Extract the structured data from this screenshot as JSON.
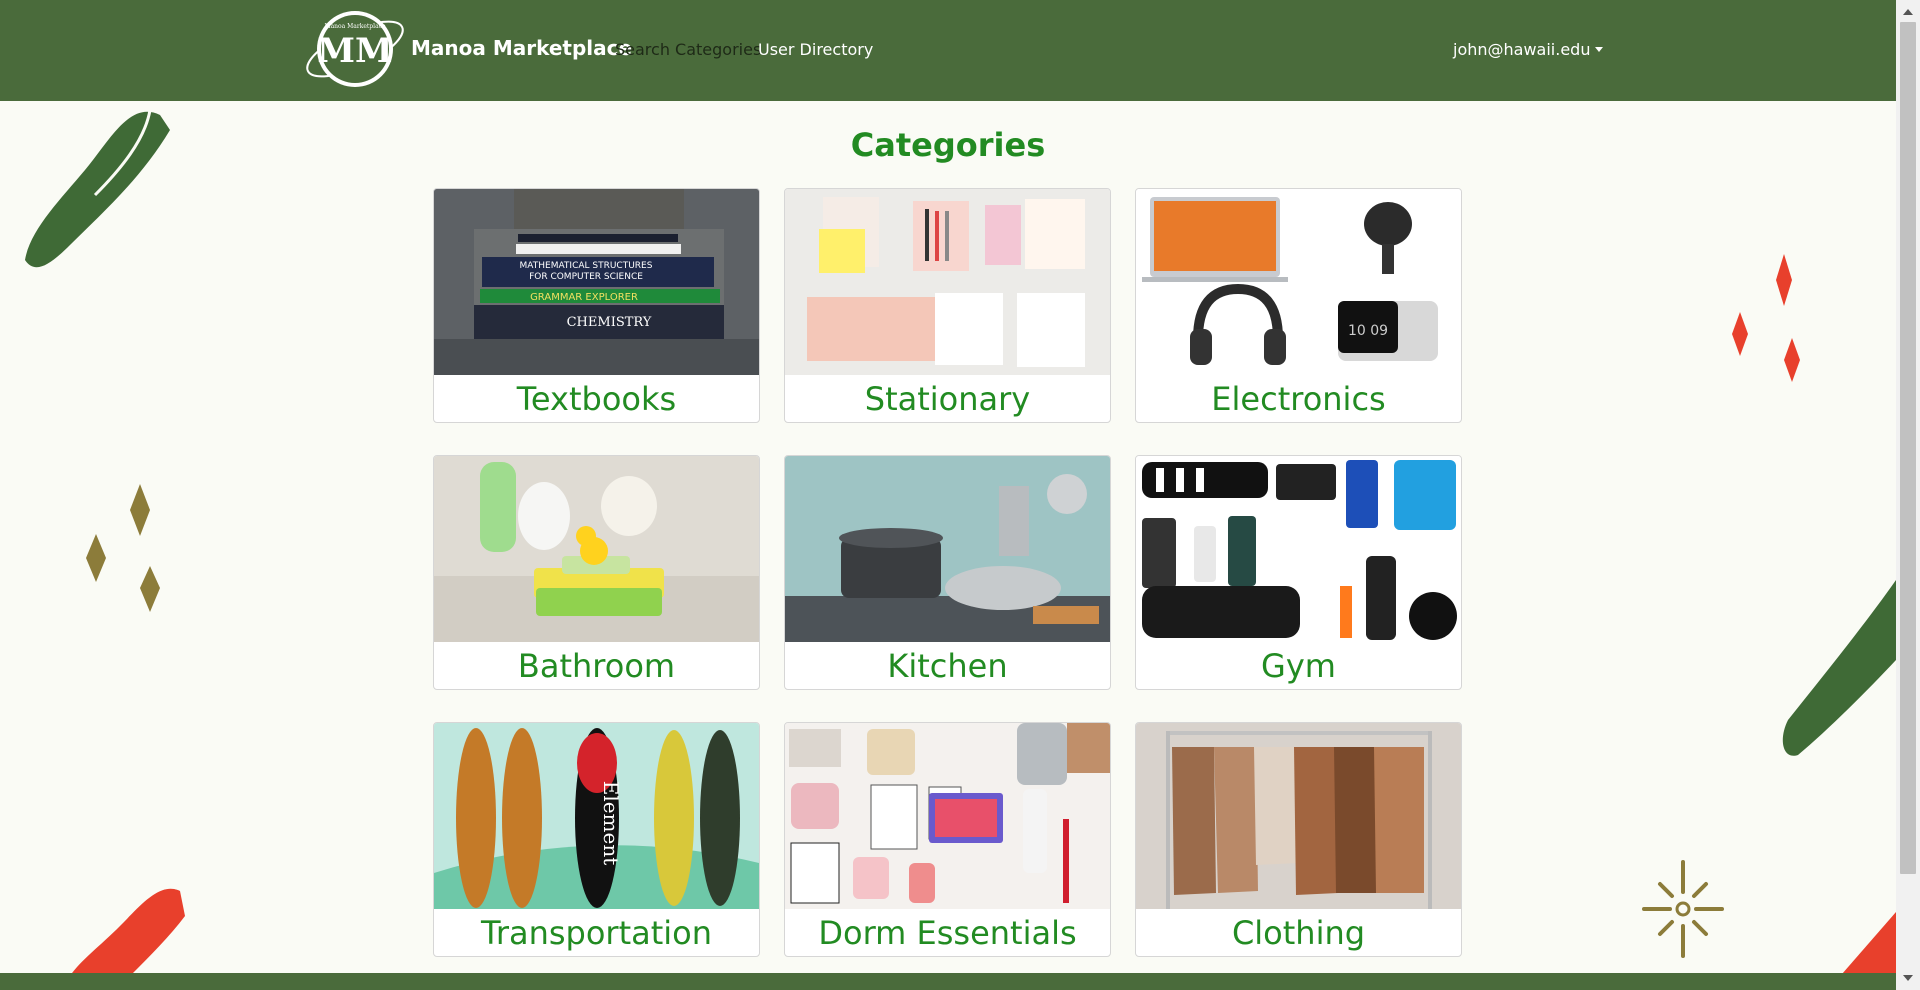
{
  "nav": {
    "brand": "Manoa Marketplace",
    "logo_text": "MM",
    "logo_ring_text": "Manoa Marketplace",
    "links": [
      "Search Categories",
      "User Directory"
    ],
    "user": "john@hawaii.edu"
  },
  "page": {
    "title": "Categories"
  },
  "categories": [
    {
      "label": "Textbooks"
    },
    {
      "label": "Stationary"
    },
    {
      "label": "Electronics"
    },
    {
      "label": "Bathroom"
    },
    {
      "label": "Kitchen"
    },
    {
      "label": "Gym"
    },
    {
      "label": "Transportation"
    },
    {
      "label": "Dorm Essentials"
    },
    {
      "label": "Clothing"
    }
  ],
  "textbook_spines": [
    "MATHEMATICAL STRUCTURES FOR COMPUTER SCIENCE",
    "GRAMMAR EXPLORER",
    "CHEMISTRY"
  ],
  "electronics_clock": "10 09",
  "skateboard_brand": "Element",
  "colors": {
    "navbar": "#4a6b3b",
    "accent_green": "#228b22",
    "background": "#fafbf5",
    "red_decor": "#e8402c",
    "gold_decor": "#8c7c3a"
  }
}
